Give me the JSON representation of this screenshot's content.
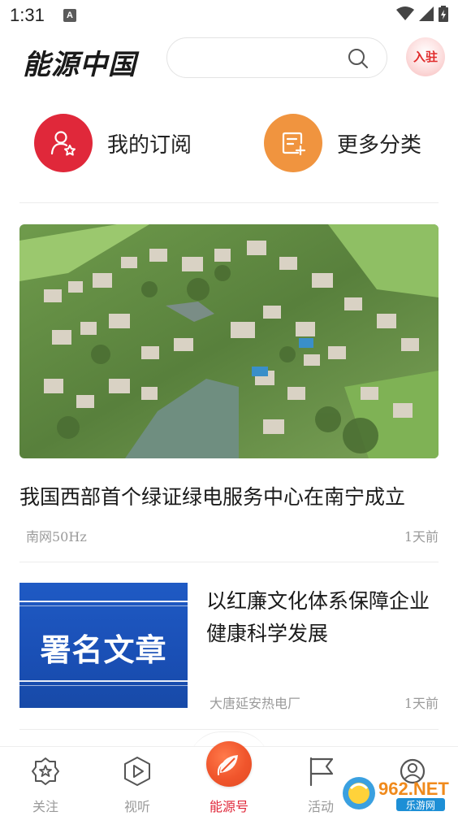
{
  "status_bar": {
    "time": "1:31",
    "a_badge": "A"
  },
  "header": {
    "logo_main": "能源中国",
    "search_placeholder": "",
    "join_label": "入驻"
  },
  "quick_actions": [
    {
      "label": "我的订阅",
      "color": "#e0283a",
      "icon": "user-star-icon"
    },
    {
      "label": "更多分类",
      "color": "#f0943f",
      "icon": "document-add-icon"
    }
  ],
  "articles": [
    {
      "title": "我国西部首个绿证绿电服务中心在南宁成立",
      "source": "南网50Hz",
      "time": "1天前",
      "image": "aerial-village-photo"
    },
    {
      "title": "以红廉文化体系保障企业健康科学发展",
      "source": "大唐延安热电厂",
      "time": "1天前",
      "thumb_text": "署名文章"
    }
  ],
  "bottom_nav": [
    {
      "label": "关注",
      "icon": "star-badge-icon",
      "active": false
    },
    {
      "label": "视听",
      "icon": "play-hex-icon",
      "active": false
    },
    {
      "label": "能源号",
      "icon": "leaf-icon",
      "active": true
    },
    {
      "label": "活动",
      "icon": "flag-icon",
      "active": false
    },
    {
      "label": "",
      "icon": "profile-icon",
      "active": false
    }
  ],
  "watermark": {
    "brand": "962.NET",
    "sub": "乐游网"
  },
  "colors": {
    "accent_red": "#e0283a",
    "accent_orange": "#f0943f",
    "nav_active": "#f0552c"
  }
}
